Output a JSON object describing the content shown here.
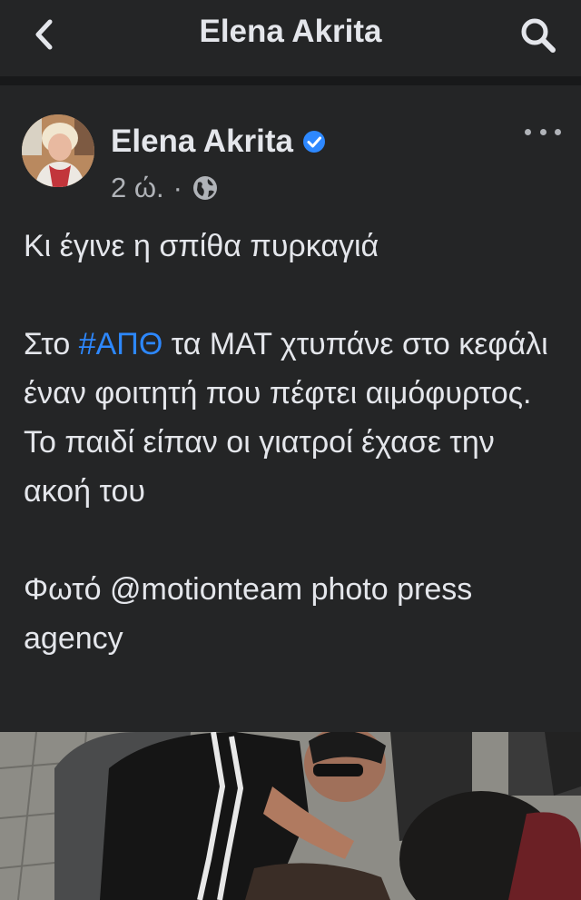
{
  "header": {
    "title": "Elena Akrita",
    "back_icon": "chevron-left-icon",
    "search_icon": "search-icon"
  },
  "post": {
    "author": "Elena Akrita",
    "verified": true,
    "time": "2 ώ.",
    "separator": "·",
    "audience_icon": "globe-icon",
    "more_icon": "more-horizontal-icon",
    "text": {
      "line1": "Κι έγινε η σπίθα πυρκαγιά",
      "para2_prefix": "Στο ",
      "hashtag": "#ΑΠΘ",
      "para2_rest": " τα ΜΑΤ χτυπάνε στο κεφάλι έναν φοιτητή που πέφτει αιμόφυρτος. Το παιδί είπαν οι γιατροί έχασε την ακοή του",
      "para3": "Φωτό @motionteam photo press agency"
    },
    "photo_alt": "Press photo of people kneeling over a student lying on the ground"
  },
  "colors": {
    "background": "#242526",
    "text": "#e4e6eb",
    "secondary_text": "#b0b3b8",
    "link": "#2d88ff",
    "verified_badge": "#2d88ff"
  }
}
